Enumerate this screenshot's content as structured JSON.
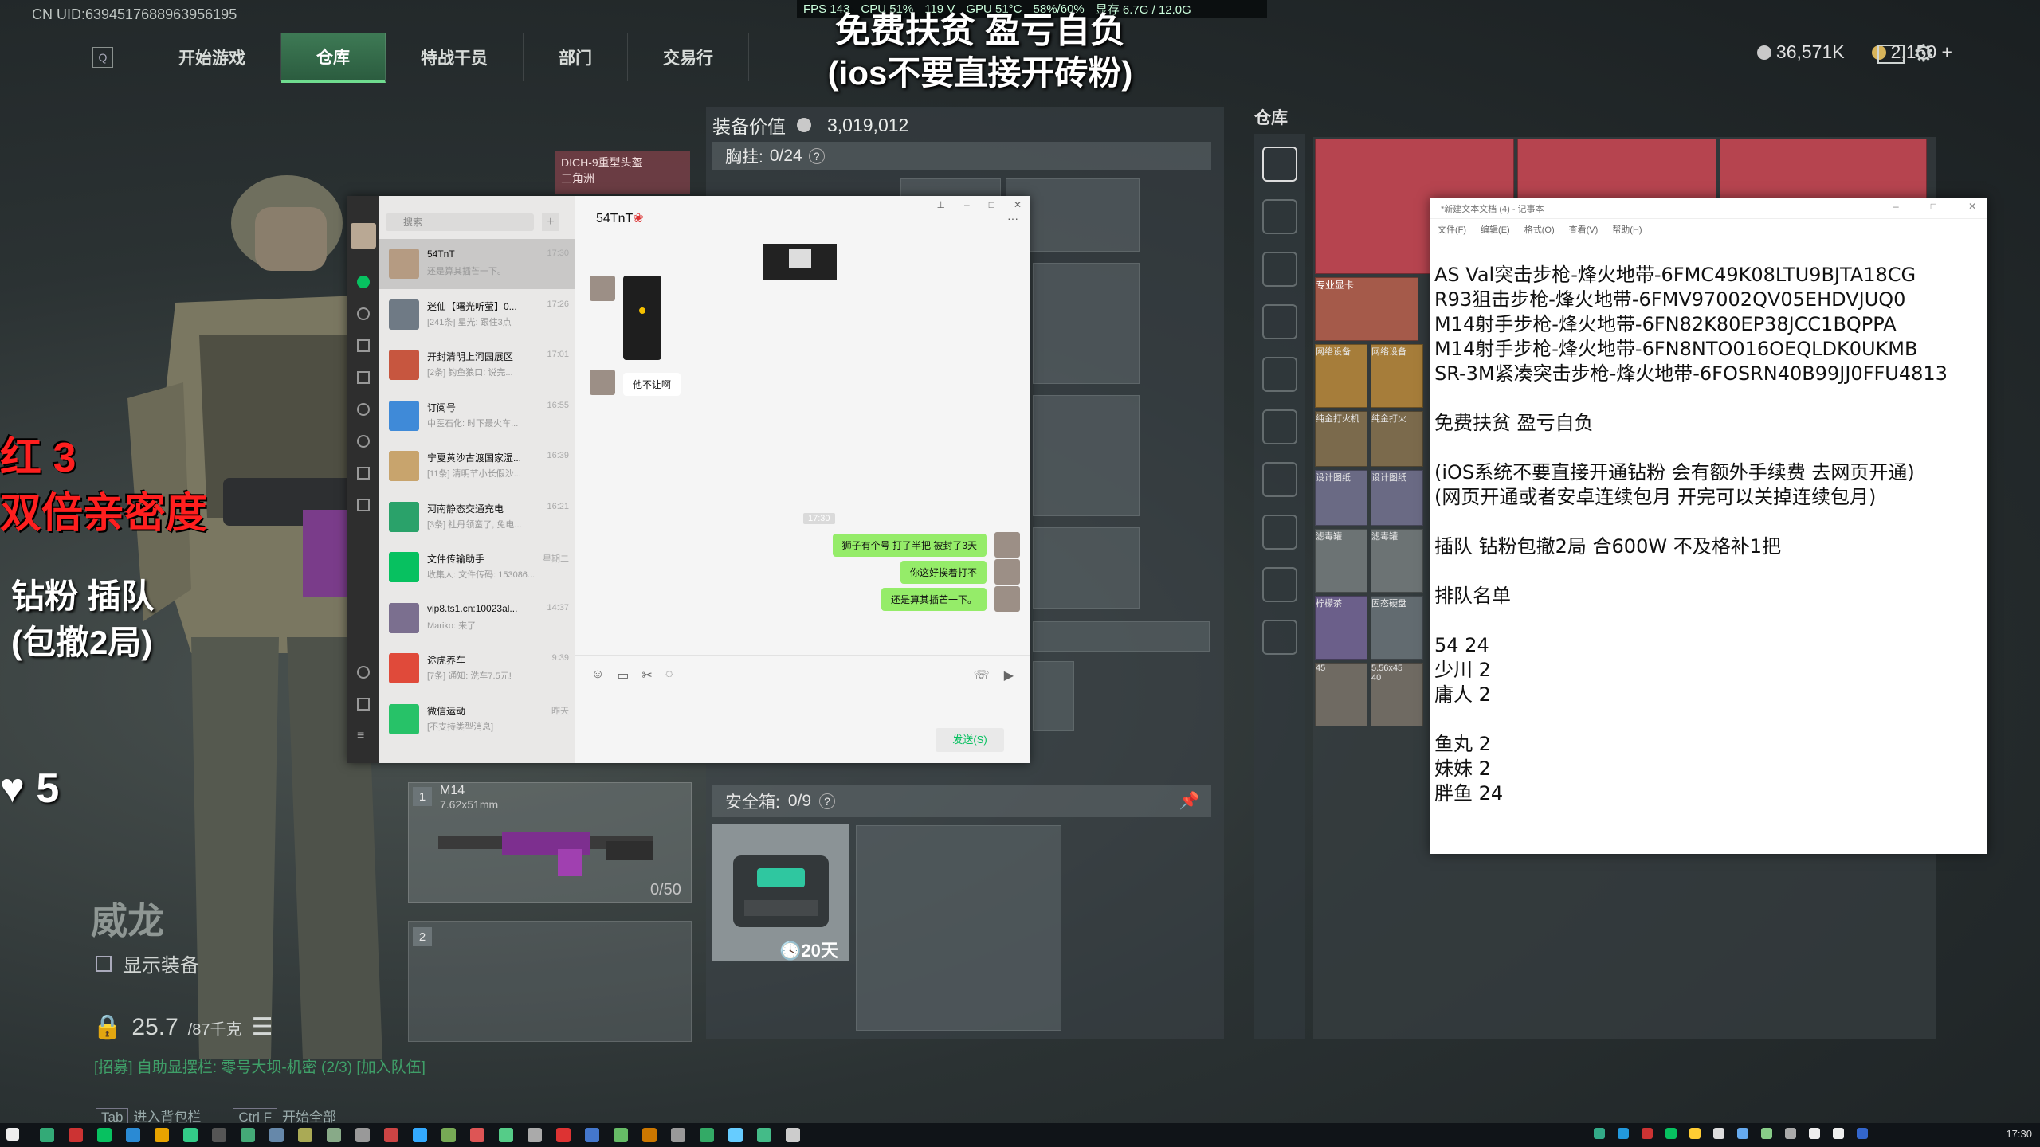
{
  "game": {
    "uid": "CN UID:6394517688963956195",
    "perf": [
      "FPS 143",
      "CPU 51%",
      "119 V",
      "GPU 51°C",
      "58%/60%",
      "显存 6.7G / 12.0G"
    ],
    "nav_badge": "Q",
    "nav_tabs": [
      "开始游戏",
      "仓库",
      "特战干员",
      "部门",
      "交易行"
    ],
    "currency": {
      "silver": "36,571K",
      "gold": "2,150 +"
    },
    "icons": [
      "mail-icon",
      "gear-icon"
    ]
  },
  "overlay": {
    "caption_line1": "免费扶贫 盈亏自负",
    "caption_line2": "(ios不要直接开砖粉)",
    "promo_red_1": "红 3",
    "promo_red_2": "双倍亲密度",
    "promo_white_1": "钻粉 插队",
    "promo_white_2": "(包撤2局)",
    "likes": "♥ 5"
  },
  "character": {
    "name": "威龙",
    "show_equip_label": "显示装备",
    "weight": "25.7",
    "weight_max": "/87千克",
    "recruit_text": "[招募] 自助显摆栏: 零号大坝-机密 (2/3)  [加入队伍]",
    "hotkey1_key": "Tab",
    "hotkey1_label": "进入背包栏",
    "hotkey2_key": "Ctrl F",
    "hotkey2_label": "开始全部"
  },
  "equipment": {
    "value_label": "装备价值",
    "value": "3,019,012",
    "chest_label": "胸挂: ",
    "chest_value": "0/24",
    "dich_card": "DICH-9重型头盔",
    "dich_sub": "三角洲",
    "weapon_slot_1": "1",
    "weapon_slot_2": "2",
    "weapon_name": "M14",
    "weapon_caliber": "7.62x51mm",
    "weapon_ammo": "0/50",
    "safe_label": "安全箱: ",
    "safe_value": "0/9",
    "safe_days": "20天"
  },
  "warehouse": {
    "title": "仓库",
    "item_labels": [
      "专业显卡",
      "网络设备",
      "网络设备",
      "纯金打火机",
      "纯金打火",
      "设计图纸",
      "设计图纸",
      "滤毒罐",
      "滤毒罐",
      "柠檬茶",
      "固态硬盘",
      "45",
      "5.56x45",
      "40"
    ]
  },
  "wechat": {
    "search_placeholder": "搜索",
    "chat_title": "54TnT",
    "contacts": [
      {
        "name": "54TnT",
        "preview": "还是算其插芒一下。",
        "time": "17:30"
      },
      {
        "name": "迷仙【曙光听萤】0...",
        "preview": "[241条] 星光: 跟住3点",
        "time": "17:26"
      },
      {
        "name": "开封清明上河园展区",
        "preview": "[2条] 钓鱼狼口: 说完...",
        "time": "17:01"
      },
      {
        "name": "订阅号",
        "preview": "中医石化: 时下最火车...",
        "time": "16:55"
      },
      {
        "name": "宁夏黄沙古渡国家湿...",
        "preview": "[11条] 清明节小长假沙...",
        "time": "16:39"
      },
      {
        "name": "河南静态交通充电",
        "preview": "[3条] 社丹领蛮了, 免电...",
        "time": "16:21"
      },
      {
        "name": "文件传输助手",
        "preview": "收集人: 文件传码: 153086...",
        "time": "星期二"
      },
      {
        "name": "vip8.ts1.cn:10023al...",
        "preview": "Mariko: 来了",
        "time": "14:37"
      },
      {
        "name": "途虎养车",
        "preview": "[7条] 通知: 洗车7.5元!",
        "time": "9:39"
      },
      {
        "name": "微信运动",
        "preview": "[不支持类型消息]",
        "time": "昨天"
      }
    ],
    "messages": {
      "left_text": "他不让啊",
      "time_stamp": "17:30",
      "right_1": "狮子有个号 打了半把 被封了3天",
      "right_2": "你这好挨着打不",
      "right_3": "还是算其插芒一下。"
    },
    "send_label": "发送(S)"
  },
  "notepad": {
    "title": "*新建文本文档 (4) - 记事本",
    "menu": [
      "文件(F)",
      "编辑(E)",
      "格式(O)",
      "查看(V)",
      "帮助(H)"
    ],
    "lines": [
      "AS Val突击步枪-烽火地带-6FMC49K08LTU9BJTA18CG",
      "R93狙击步枪-烽火地带-6FMV97002QV05EHDVJUQ0",
      "M14射手步枪-烽火地带-6FN82K80EP38JCC1BQPPA",
      "M14射手步枪-烽火地带-6FN8NTO016OEQLDK0UKMB",
      "SR-3M紧凑突击步枪-烽火地带-6FOSRN40B99JJ0FFU4813",
      "",
      "免费扶贫 盈亏自负",
      "",
      "(iOS系统不要直接开通钻粉 会有额外手续费 去网页开通)",
      "(网页开通或者安卓连续包月 开完可以关掉连续包月)",
      "",
      "插队 钻粉包撤2局 合600W 不及格补1把",
      "",
      "排队名单",
      "",
      "54 24",
      "少川 2",
      "庸人 2",
      "",
      "鱼丸 2",
      "妹妹 2",
      "胖鱼 24"
    ]
  },
  "taskbar": {
    "time": "17:30"
  }
}
